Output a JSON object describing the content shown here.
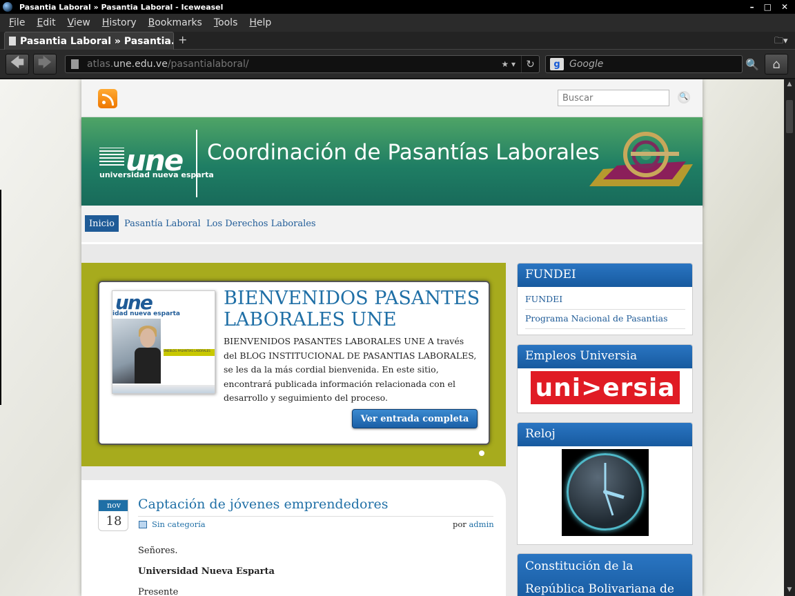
{
  "window": {
    "title": "Pasantia Laboral » Pasantia Laboral - Iceweasel",
    "controls": [
      "–",
      "□",
      "✕"
    ]
  },
  "menu": [
    "File",
    "Edit",
    "View",
    "History",
    "Bookmarks",
    "Tools",
    "Help"
  ],
  "tab": {
    "label": "Pasantia Laboral » Pasantia...",
    "new_tab": "+"
  },
  "nav": {
    "back": "🡄",
    "forward": "🡆",
    "reload": "↻",
    "home": "⌂",
    "star": "★ ▾"
  },
  "url": {
    "prefix": "atlas.",
    "host": "une.edu.ve",
    "path": "/pasantialaboral/"
  },
  "search": {
    "engine_glyph": "g",
    "placeholder": "Google"
  },
  "site": {
    "search_placeholder": "Buscar",
    "search_button": "🔍",
    "logo_text": "une",
    "logo_sub": "universidad nueva esparta",
    "banner_title": "Coordinación de Pasantías Laborales",
    "menu": [
      "Inicio",
      "Pasantía Laboral",
      "Los Derechos Laborales"
    ]
  },
  "featured": {
    "title": "BIENVENIDOS PASANTES LABORALES UNE",
    "text": "BIENVENIDOS PASANTES LABORALES UNE A través del BLOG INSTITUCIONAL DE PASANTIAS LABORALES, se les da la más cordial bienvenida. En este sitio, encontrará publicada información relacionada con el desarrollo y seguimiento del proceso.",
    "button": "Ver entrada completa",
    "thumb_logo": "une",
    "thumb_sub": "idad nueva esparta",
    "thumb_strip": "UNEBLOG PASANTIAS LABORALES"
  },
  "post": {
    "month": "nov",
    "day": "18",
    "title": "Captación de jóvenes emprendedores",
    "category": "Sin categoría",
    "by_label": "por",
    "author": "admin",
    "p1": "Señores.",
    "p2": "Universidad Nueva Esparta",
    "p3": "Presente"
  },
  "sidebar": {
    "fundei": {
      "title": "FUNDEI",
      "links": [
        "FUNDEI",
        "Programa Nacional de Pasantias"
      ]
    },
    "empleos": {
      "title": "Empleos Universia",
      "logo": "uni>ersia"
    },
    "reloj": {
      "title": "Reloj"
    },
    "constitucion": {
      "title": "Constitución de la República Bolivariana de"
    }
  },
  "colors": {
    "accent": "#1f5b97",
    "featured_bg": "#a7ab1d",
    "banner": "#1f7e64",
    "universia": "#e01b24"
  }
}
